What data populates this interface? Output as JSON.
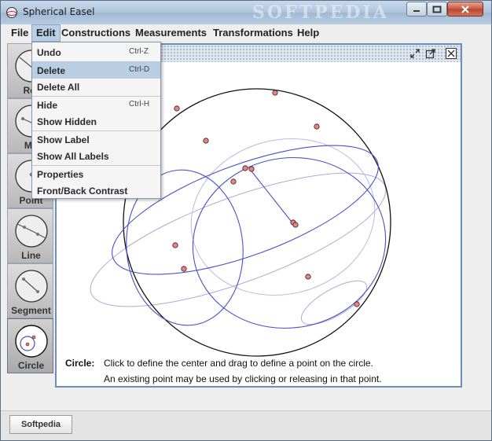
{
  "window": {
    "title": "Spherical Easel",
    "watermark": "SOFTPEDIA"
  },
  "menubar": {
    "items": [
      "File",
      "Edit",
      "Constructions",
      "Measurements",
      "Transformations",
      "Help"
    ]
  },
  "edit_menu": {
    "items": [
      {
        "label": "Undo",
        "shortcut": "Ctrl-Z"
      },
      {
        "label": "Delete",
        "shortcut": "Ctrl-D"
      },
      {
        "label": "Delete All",
        "shortcut": ""
      },
      {
        "label": "Hide",
        "shortcut": "Ctrl-H"
      },
      {
        "label": "Show Hidden",
        "shortcut": ""
      },
      {
        "label": "Show Label",
        "shortcut": ""
      },
      {
        "label": "Show All Labels",
        "shortcut": ""
      },
      {
        "label": "Properties",
        "shortcut": ""
      },
      {
        "label": "Front/Back Contrast",
        "shortcut": ""
      }
    ],
    "highlighted": "Delete"
  },
  "tools": [
    {
      "label": "Rot",
      "icon": "rotate-icon"
    },
    {
      "label": "Mo",
      "icon": "move-icon"
    },
    {
      "label": "Point",
      "icon": "point-icon"
    },
    {
      "label": "Line",
      "icon": "line-icon"
    },
    {
      "label": "Segment",
      "icon": "segment-icon"
    },
    {
      "label": "Circle",
      "icon": "circle-icon",
      "selected": true
    }
  ],
  "status": {
    "tool_name": "Circle:",
    "line1": "Click to define the center and drag to define a point on the circle.",
    "line2": "An existing point may be used by clicking or releasing in that point."
  },
  "bottom_tab": "Softpedia",
  "colors": {
    "point_fill": "#f08080",
    "great_circle": "#4a4fc8",
    "sphere": "#000000",
    "menu_highlight": "#b9cde3"
  }
}
